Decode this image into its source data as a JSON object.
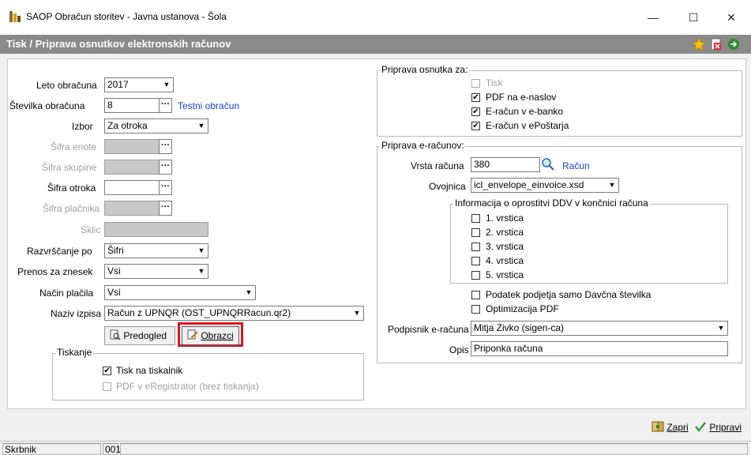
{
  "window": {
    "title": "SAOP Obračun storitev - Javna ustanova - Šola",
    "minimize": "—",
    "maximize": "☐",
    "close": "✕"
  },
  "header": {
    "title": "Tisk / Priprava osnutkov elektronskih računov"
  },
  "left": {
    "leto_label": "Leto obračuna",
    "leto_value": "2017",
    "stevilka_label": "Številka obračuna",
    "stevilka_value": "8",
    "stevilka_link": "Testni obračun",
    "izbor_label": "Izbor",
    "izbor_value": "Za otroka",
    "sifra_enote_label": "Šifra enote",
    "sifra_skupine_label": "Šifra skupine",
    "sifra_otroka_label": "Šifra otroka",
    "sifra_placnika_label": "Šifra plačnika",
    "sklic_label": "Sklic",
    "razvrscanje_label": "Razvrščanje po",
    "razvrscanje_value": "Šifri",
    "prenos_label": "Prenos za znesek",
    "prenos_value": "Vsi",
    "nacin_label": "Način plačila",
    "nacin_value": "Vsi",
    "naziv_label": "Naziv izpisa",
    "naziv_value": "Račun z UPNQR  (OST_UPNQRRacun.qr2)",
    "predogled_label": "Predogled",
    "obrazci_label": "Obrazci",
    "tiskanje_title": "Tiskanje",
    "tisk_label": "Tisk na tiskalnik",
    "pdf_label": "PDF v eRegistrator (brez tiskanja)"
  },
  "osnutek": {
    "title": "Priprava osnutka za:",
    "items": [
      {
        "label": "Tisk",
        "checked": false,
        "disabled": true
      },
      {
        "label": "PDF na e-naslov",
        "checked": true,
        "disabled": false
      },
      {
        "label": "E-račun v e-banko",
        "checked": true,
        "disabled": false
      },
      {
        "label": "E-račun v ePoštarja",
        "checked": true,
        "disabled": false
      }
    ]
  },
  "eracuni": {
    "title": "Priprava e-računov:",
    "vrsta_label": "Vrsta računa",
    "vrsta_value": "380",
    "vrsta_link": "Račun",
    "ovojnica_label": "Ovojnica",
    "ovojnica_value": "icl_envelope_einvoice.xsd",
    "ddv_title": "Informacija o oprostitvi DDV v končnici računa",
    "ddv_rows": [
      "1. vrstica",
      "2. vrstica",
      "3. vrstica",
      "4. vrstica",
      "5. vrstica"
    ],
    "davcna_label": "Podatek podjetja samo Davčna številka",
    "optim_label": "Optimizacija PDF",
    "podpisnik_label": "Podpisnik e-računa",
    "podpisnik_value": "Mitja Zivko (sigen-ca)",
    "opis_label": "Opis",
    "opis_value": "Priponka računa"
  },
  "footer": {
    "zapri_label": "Zapri",
    "pripravi_label": "Pripravi"
  },
  "status": {
    "user": "Skrbnik",
    "code": "001"
  }
}
